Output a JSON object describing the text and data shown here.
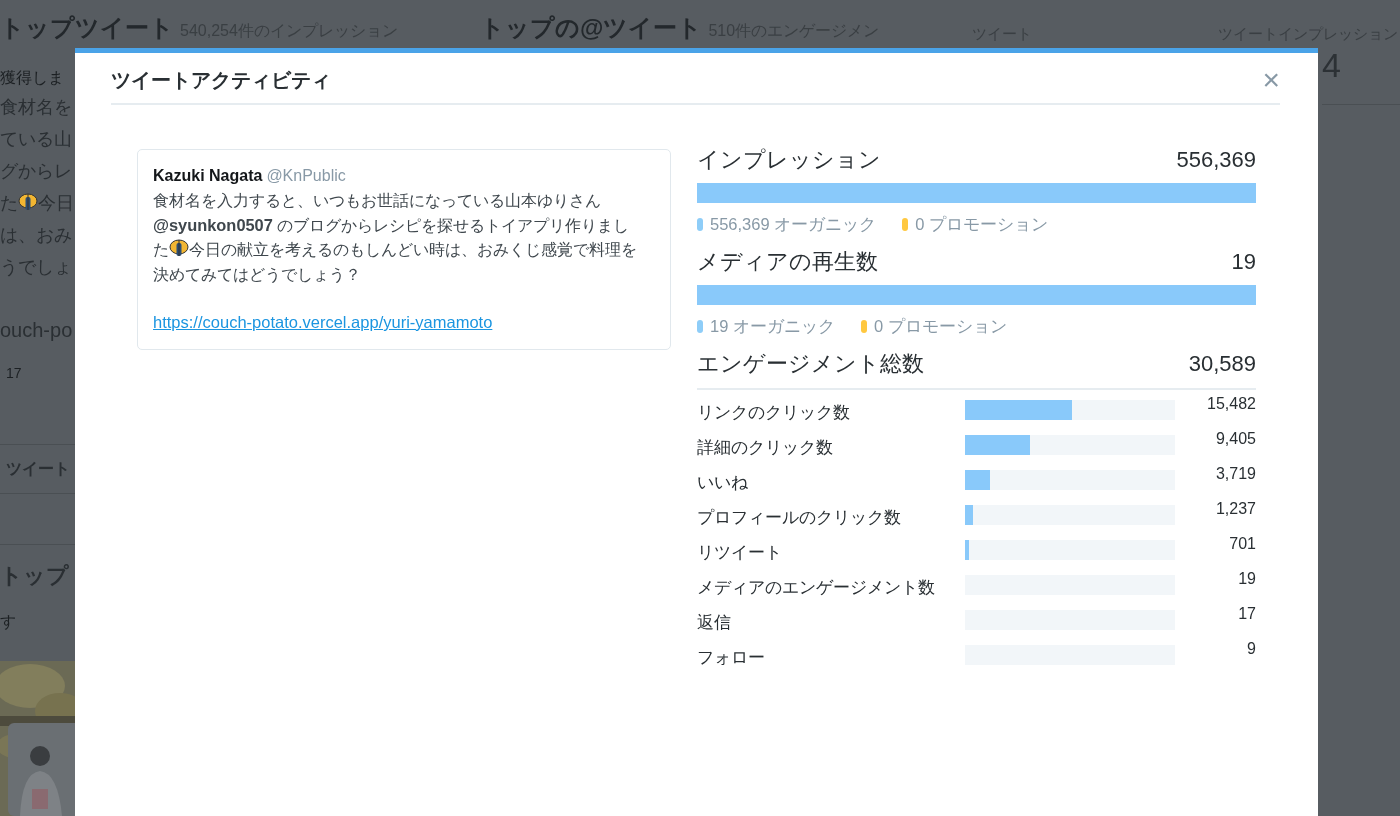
{
  "background": {
    "top": [
      {
        "title": "トップツイート",
        "subtitle": "540,254件のインプレッション"
      },
      {
        "title": "トップの@ツイート",
        "subtitle": "510件のエンゲージメン"
      },
      {
        "label": "ツイート"
      },
      {
        "label": "ツイートインプレッション"
      }
    ],
    "left": [
      {
        "kind": "muted",
        "text": "獲得しま"
      },
      {
        "kind": "body",
        "text": "食材名を"
      },
      {
        "kind": "body",
        "text": "ている山"
      },
      {
        "kind": "body",
        "text": "グからレ"
      },
      {
        "kind": "emoji",
        "text": "た",
        "after": "今日"
      },
      {
        "kind": "body",
        "text": "は、おみ"
      },
      {
        "kind": "body",
        "text": "うでしょ"
      },
      {
        "kind": "link",
        "text": "ouch-po"
      },
      {
        "kind": "stat",
        "text": "17"
      },
      {
        "kind": "tab",
        "text": "ツイート"
      },
      {
        "kind": "heading",
        "text": "トップ"
      },
      {
        "kind": "muted",
        "text": "す"
      },
      {
        "kind": "picture"
      }
    ],
    "right": [
      {
        "kind": "big",
        "text": "4"
      }
    ]
  },
  "modal": {
    "title": "ツイートアクティビティ",
    "close": "×",
    "tweet": {
      "name": "Kazuki Nagata",
      "handle": "@KnPublic",
      "text_parts": [
        "食材名を入力すると、いつもお世話になっている山本ゆりさん**@syunkon0507** のブログからレシピを探せるトイアプリ作りました",
        "今日の献立を考えるのもしんどい時は、おみくじ感覚で料理を決めてみてはどうでしょう？"
      ],
      "link": "https://couch-potato.vercel.app/yuri-yamamoto "
    },
    "metrics": [
      {
        "title": "インプレッション",
        "total": "556,369",
        "level": 1,
        "legend": [
          {
            "text": "556,369 オーガニック",
            "color": "#8ecdf8"
          },
          {
            "text": "0 プロモーション",
            "color": "#ffc840"
          }
        ]
      },
      {
        "title": "メディアの再生数",
        "total": "19",
        "level": 1,
        "legend": [
          {
            "text": "19 オーガニック",
            "color": "#8ecdf8"
          },
          {
            "text": "0 プロモーション",
            "color": "#ffc840"
          }
        ]
      }
    ],
    "engagement": {
      "title": "エンゲージメント総数",
      "total": "30,589",
      "rows": [
        {
          "label": "リンクのクリック数",
          "value": "15,482",
          "level": 0.51
        },
        {
          "label": "詳細のクリック数",
          "value": "9,405",
          "level": 0.31
        },
        {
          "label": "いいね",
          "value": "3,719",
          "level": 0.12
        },
        {
          "label": "プロフィールのクリック数",
          "value": "1,237",
          "level": 0.04
        },
        {
          "label": "リツイート",
          "value": "701",
          "level": 0.02
        },
        {
          "label": "メディアのエンゲージメント数",
          "value": "19",
          "level": 0
        },
        {
          "label": "返信",
          "value": "17",
          "level": 0
        },
        {
          "label": "フォロー",
          "value": "9",
          "level": 0
        }
      ]
    }
  }
}
